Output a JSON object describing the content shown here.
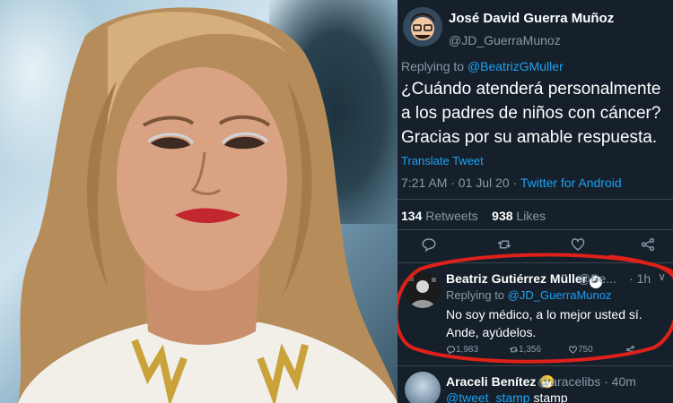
{
  "photo": {
    "alt": "Photo of a woman with shoulder-length blonde hair and red lipstick"
  },
  "tweet": {
    "author_name": "José David Guerra Muñoz",
    "author_handle": "@JD_GuerraMunoz",
    "replying_prefix": "Replying to",
    "replying_to": "@BeatrizGMuller",
    "text_line1": "¿Cuándo atenderá personalmente",
    "text_line2": "a los padres de niños con cáncer?",
    "text_line3": "Gracias por su amable respuesta.",
    "translate_label": "Translate Tweet",
    "time": "7:21 AM · 01 Jul 20 ·",
    "source": "Twitter for Android",
    "retweets_count": "134",
    "retweets_label": "Retweets",
    "likes_count": "938",
    "likes_label": "Likes",
    "icons": [
      "reply-icon",
      "retweet-icon",
      "like-icon",
      "share-icon"
    ]
  },
  "reply": {
    "author_name": "Beatriz Gutiérrez Müller",
    "verified_glyph": "✓",
    "author_handle": "@Be...",
    "time": "· 1h",
    "replying_prefix": "Replying to",
    "replying_to": "@JD_GuerraMunoz",
    "text": "No soy médico, a lo mejor usted sí. Ande, ayúdelos.",
    "replies_count": "1,983",
    "retweets_count": "1,356",
    "likes_count": "750"
  },
  "next_tweet": {
    "author_name": "Araceli Benítez",
    "emoji": "😷",
    "author_handle": "@aracelibs · 40m",
    "mention": "@tweet_stamp",
    "text": "stamp"
  },
  "colors": {
    "background": "#15202b",
    "link": "#1da1f2",
    "muted": "#8899a6",
    "highlight": "#e0201a"
  }
}
